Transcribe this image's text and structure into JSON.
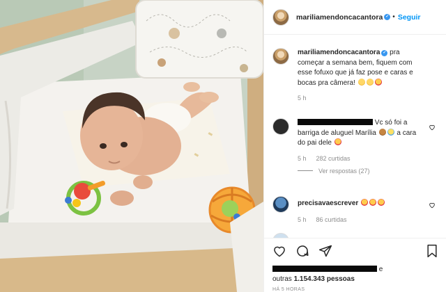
{
  "post": {
    "username": "mariliamendoncacantora",
    "follow_label": "Seguir",
    "caption_username": "mariliamendoncacantora",
    "caption_text": "pra começar a semana bem, fiquem com esse fofuxo que já faz pose e caras e bocas pra câmera!",
    "caption_time": "5 h"
  },
  "comments": [
    {
      "text_line1": "Vc só foi a",
      "text_line2": "barriga de aluguel Marília",
      "text_line3": "a cara do pai dele",
      "time": "5 h",
      "likes": "282 curtidas",
      "replies": "Ver respostas (27)"
    },
    {
      "username": "precisavaescrever",
      "time": "5 h",
      "likes": "86 curtidas"
    }
  ],
  "footer": {
    "likes_prefix": "outras",
    "likes_count": "1.154.343",
    "likes_suffix": "pessoas",
    "likes_connector": "e",
    "timestamp": "HÁ 5 HORAS"
  },
  "icons": {
    "verified": "verified-badge-icon",
    "like": "heart-icon",
    "comment": "comment-bubble-icon",
    "share": "paper-plane-icon",
    "save": "bookmark-icon"
  },
  "colors": {
    "link_blue": "#0095f6",
    "verified_blue": "#3897f0",
    "muted_text": "#8e8e8e"
  }
}
